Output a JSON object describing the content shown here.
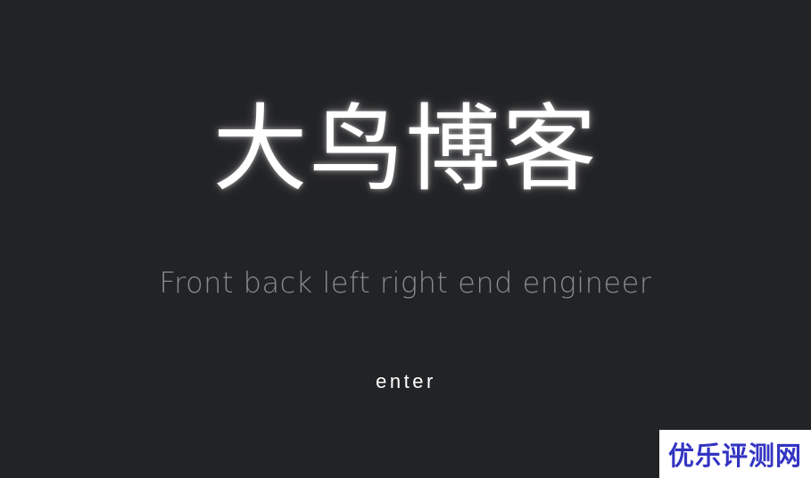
{
  "hero": {
    "title": "大鸟博客",
    "subtitle": "Front back left right end engineer",
    "enter_label": "enter"
  },
  "watermark": {
    "text": "优乐评测网"
  },
  "colors": {
    "background": "#222325",
    "title": "#ffffff",
    "subtitle": "#8a8b8d",
    "watermark_text": "#3334c2",
    "watermark_bg": "#ffffff"
  }
}
